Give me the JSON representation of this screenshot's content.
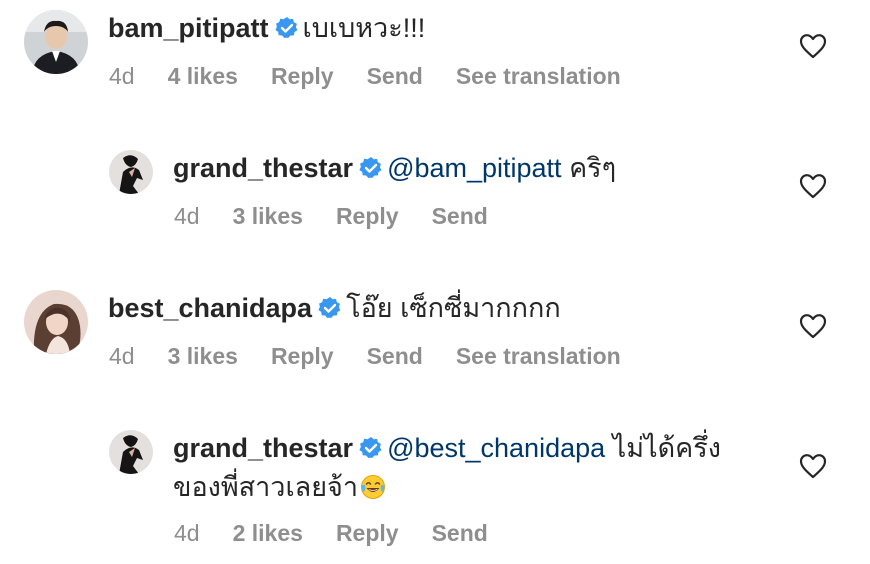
{
  "comments": [
    {
      "username": "bam_pitipatt",
      "mention": "",
      "text": "เบเบหวะ!!!",
      "time": "4d",
      "likes": "4 likes",
      "reply": "Reply",
      "send": "Send",
      "translation": "See translation"
    },
    {
      "username": "grand_thestar",
      "mention": "@bam_pitipatt",
      "text": " คริๆ",
      "time": "4d",
      "likes": "3 likes",
      "reply": "Reply",
      "send": "Send"
    },
    {
      "username": "best_chanidapa",
      "mention": "",
      "text": "โอ๊ย เซ็กซี่มากกกก",
      "time": "4d",
      "likes": "3 likes",
      "reply": "Reply",
      "send": "Send",
      "translation": "See translation"
    },
    {
      "username": "grand_thestar",
      "mention": "@best_chanidapa",
      "text": " ไม่ได้ครึ่ง",
      "text_cont": "ของพี่สาวเลยจ้า",
      "emoji": "face-with-tears-of-joy-emoji",
      "time": "4d",
      "likes": "2 likes",
      "reply": "Reply",
      "send": "Send"
    }
  ],
  "colors": {
    "text": "#262626",
    "meta": "#8e8e8e",
    "mention": "#00376b",
    "verified": "#3897f0"
  },
  "icons": {
    "verified": "verified-badge-icon",
    "like": "heart-outline-icon"
  }
}
